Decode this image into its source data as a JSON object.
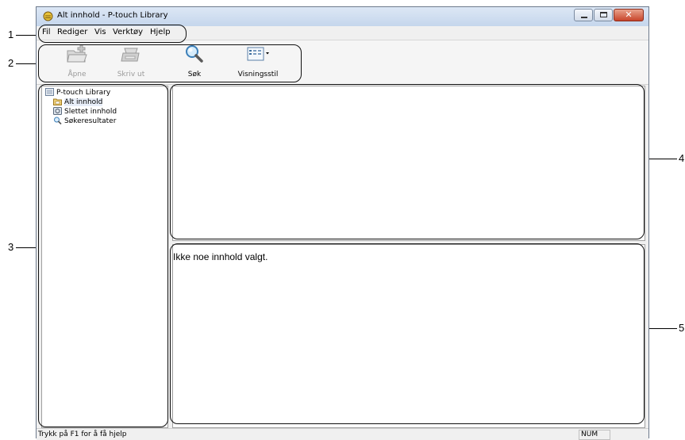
{
  "window": {
    "title": "Alt innhold - P-touch Library"
  },
  "menu": [
    "Fil",
    "Rediger",
    "Vis",
    "Verktøy",
    "Hjelp"
  ],
  "toolbar": [
    {
      "label": "Åpne",
      "icon": "open-folder-icon",
      "enabled": false
    },
    {
      "label": "Skriv ut",
      "icon": "printer-icon",
      "enabled": false
    },
    {
      "label": "Søk",
      "icon": "search-icon",
      "enabled": true
    },
    {
      "label": "Visningsstil",
      "icon": "view-style-icon",
      "enabled": true
    }
  ],
  "tree": {
    "root": "P-touch Library",
    "items": [
      "Alt innhold",
      "Slettet innhold",
      "Søkeresultater"
    ]
  },
  "preview": {
    "message": "Ikke noe innhold valgt."
  },
  "status": {
    "help": "Trykk på F1 for å få hjelp",
    "num": "NUM"
  },
  "callouts": [
    "1",
    "2",
    "3",
    "4",
    "5"
  ]
}
